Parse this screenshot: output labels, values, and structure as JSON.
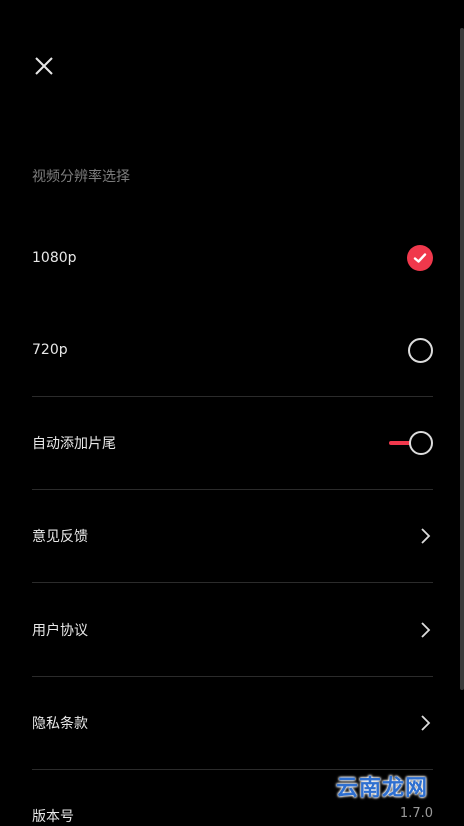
{
  "header": {
    "close_icon": "close-icon"
  },
  "resolution": {
    "section_title": "视频分辨率选择",
    "options": [
      {
        "label": "1080p",
        "selected": true
      },
      {
        "label": "720p",
        "selected": false
      }
    ]
  },
  "settings": {
    "auto_outro_label": "自动添加片尾",
    "auto_outro_on": true,
    "feedback_label": "意见反馈",
    "user_agreement_label": "用户协议",
    "privacy_label": "隐私条款",
    "version_label": "版本号",
    "version_value": "1.7.0"
  },
  "watermark": {
    "text": "云南龙网"
  },
  "colors": {
    "accent": "#f0384c",
    "background": "#000000",
    "secondary_text": "#7d7d7d"
  }
}
